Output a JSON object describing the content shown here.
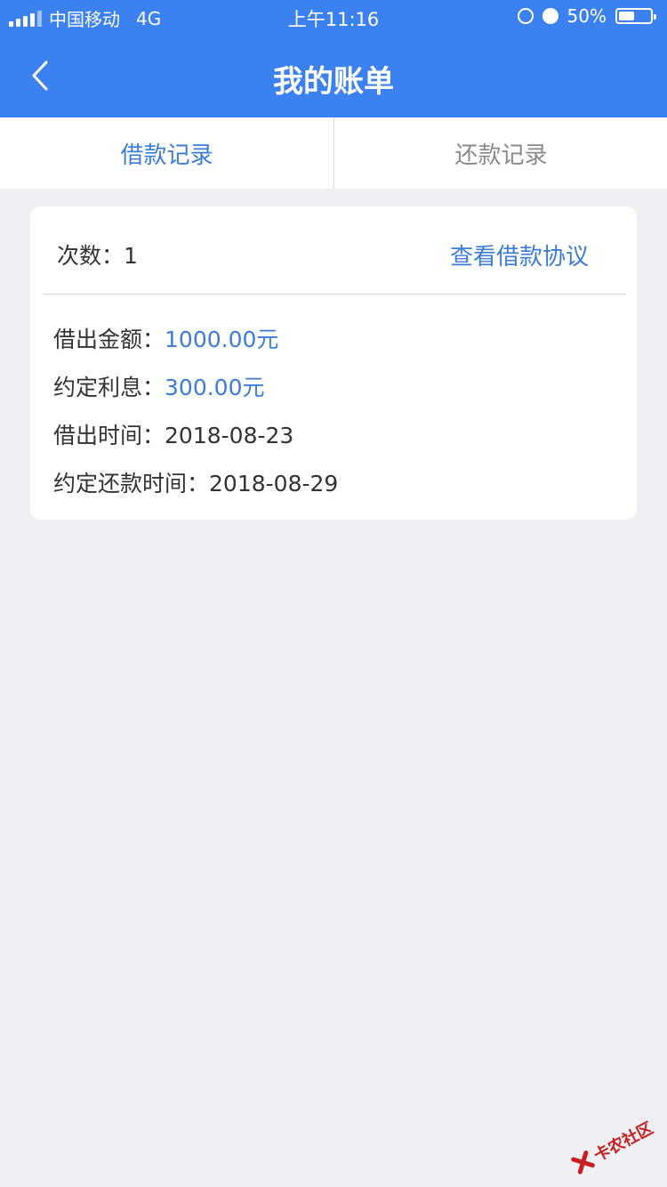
{
  "status_bar": {
    "carrier": "中国移动",
    "network": "4G",
    "time": "上午11:16",
    "battery_percent": "50%",
    "battery_level": 0.5
  },
  "nav": {
    "title": "我的账单",
    "back_icon": "chevron-left-icon"
  },
  "tabs": [
    {
      "label": "借款记录",
      "active": true
    },
    {
      "label": "还款记录",
      "active": false
    }
  ],
  "record": {
    "count_label": "次数：",
    "count_value": "1",
    "agreement_link": "查看借款协议",
    "amount_label": "借出金额：",
    "amount_value": "1000.00元",
    "interest_label": "约定利息：",
    "interest_value": "300.00元",
    "loan_time_label": "借出时间：",
    "loan_time_value": "2018-08-23",
    "repay_time_label": "约定还款时间：",
    "repay_time_value": "2018-08-29"
  },
  "watermark": {
    "text": "卡农社区"
  },
  "colors": {
    "header": "#3b82f0",
    "accent": "#3b7dd8",
    "background": "#efeff4"
  }
}
